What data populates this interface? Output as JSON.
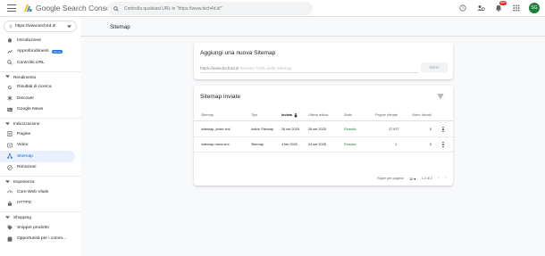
{
  "header": {
    "brand": "Google Search Console",
    "search_placeholder": "Controlla qualsiasi URL in \"https://www.tech4d.it/\"",
    "notification_count": "99+",
    "avatar_initials": "SG"
  },
  "sidebar": {
    "property": "https://www.tech4d.it/",
    "property_prefix": "Ⓢ",
    "items_top": [
      {
        "label": "Introduzione",
        "icon": "home-icon"
      },
      {
        "label": "Approfondimenti",
        "icon": "insights-icon",
        "badge": "Nuovo"
      },
      {
        "label": "Controllo URL",
        "icon": "search-icon"
      }
    ],
    "sections": [
      {
        "title": "Rendimento",
        "items": [
          {
            "label": "Risultati di ricerca",
            "icon": "g-icon"
          },
          {
            "label": "Discover",
            "icon": "asterisk-icon"
          },
          {
            "label": "Google News",
            "icon": "news-icon"
          }
        ]
      },
      {
        "title": "Indicizzazione",
        "items": [
          {
            "label": "Pagine",
            "icon": "pages-icon"
          },
          {
            "label": "Video",
            "icon": "video-icon"
          },
          {
            "label": "Sitemap",
            "icon": "sitemap-icon",
            "active": true
          },
          {
            "label": "Rimozioni",
            "icon": "removal-icon"
          }
        ]
      },
      {
        "title": "Esperienza",
        "items": [
          {
            "label": "Core Web Vitals",
            "icon": "gauge-icon"
          },
          {
            "label": "HTTPS",
            "icon": "lock-icon"
          }
        ]
      },
      {
        "title": "Shopping",
        "items": [
          {
            "label": "Snippet prodotto",
            "icon": "tag-icon"
          },
          {
            "label": "Opportunità per i comm...",
            "icon": "shop-icon"
          }
        ]
      }
    ]
  },
  "main": {
    "page_title": "Sitemap",
    "add_card": {
      "title": "Aggiungi una nuova Sitemap",
      "url_prefix": "https://www.tech4d.it/",
      "url_placeholder": "Inserisci l'URL della Sitemap",
      "submit": "INVIA"
    },
    "sent_card": {
      "title": "Sitemap inviate",
      "columns": [
        "Sitemap",
        "Tipo",
        "Inviata",
        "Ultima lettura",
        "Stato",
        "Pagine rilevate",
        "Video rilevati"
      ],
      "rows": [
        {
          "sitemap": "/sitemap_index.xml",
          "type": "Indice Sitemap",
          "submitted": "26 set 2025",
          "last_read": "28 set 2025",
          "status": "Riuscita",
          "pages": "17.977",
          "videos": "0"
        },
        {
          "sitemap": "/sitemap-news.xml",
          "type": "Sitemap",
          "submitted": "4 feb 2020",
          "last_read": "24 set 2025",
          "status": "Riuscita",
          "pages": "1",
          "videos": "0"
        }
      ],
      "rows_per_page_label": "Righe per pagina:",
      "rows_per_page_value": "10",
      "range": "1-2 di 2"
    }
  },
  "colors": {
    "accent": "#1a73e8",
    "active_nav_bg": "#e8f0fe",
    "success": "#188038",
    "avatar": "#188038",
    "notification": "#d93025"
  }
}
